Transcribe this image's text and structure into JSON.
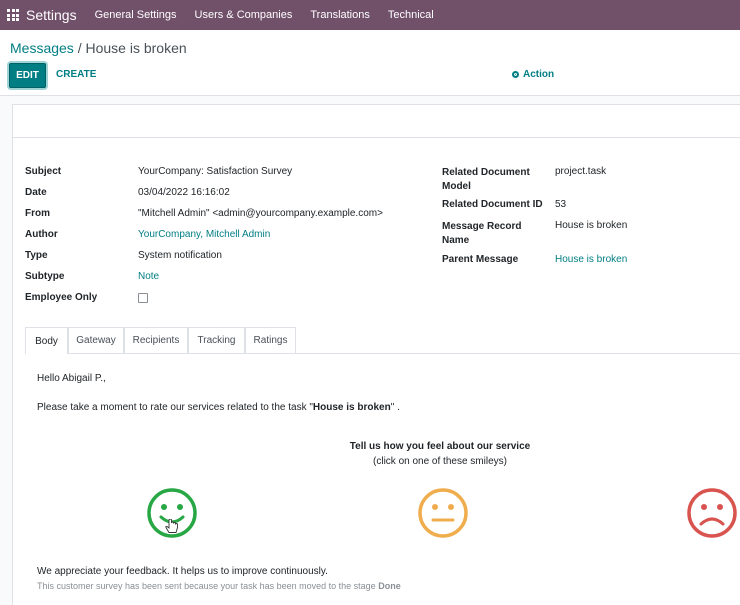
{
  "topbar": {
    "app": "Settings",
    "menus": [
      "General Settings",
      "Users & Companies",
      "Translations",
      "Technical"
    ]
  },
  "breadcrumb": {
    "parent": "Messages",
    "separator": "/",
    "current": "House is broken"
  },
  "buttons": {
    "edit": "EDIT",
    "create": "CREATE",
    "action": "Action"
  },
  "fields_left": [
    {
      "label": "Subject",
      "value": "YourCompany: Satisfaction Survey"
    },
    {
      "label": "Date",
      "value": "03/04/2022 16:16:02"
    },
    {
      "label": "From",
      "value": "\"Mitchell Admin\" <admin@yourcompany.example.com>"
    },
    {
      "label": "Author",
      "value": "YourCompany, Mitchell Admin"
    },
    {
      "label": "Type",
      "value": "System notification"
    },
    {
      "label": "Subtype",
      "value": "Note"
    },
    {
      "label": "Employee Only",
      "value": ""
    }
  ],
  "fields_right": [
    {
      "label": "Related Document Model",
      "label_l1": "Related Document",
      "label_l2": "Model",
      "value": "project.task"
    },
    {
      "label": "Related Document ID",
      "value": "53"
    },
    {
      "label": "Message Record Name",
      "label_l1": "Message Record",
      "label_l2": "Name",
      "value": "House is broken"
    },
    {
      "label": "Parent Message",
      "value": "House is broken"
    }
  ],
  "tabs": [
    "Body",
    "Gateway",
    "Recipients",
    "Tracking",
    "Ratings"
  ],
  "body": {
    "greeting": "Hello Abigail P.,",
    "intro_pre": "Please take a moment to rate our services related to the task \"",
    "intro_task": "House is broken",
    "intro_post": "\" .",
    "prompt_l1": "Tell us how you feel about our service",
    "prompt_l2": "(click on one of these smileys)",
    "thanks": "We appreciate your feedback. It helps us to improve continuously.",
    "footer_pre": "This customer survey has been sent because your task has been moved to the stage ",
    "footer_stage": "Done"
  },
  "colors": {
    "topbar": "#71506a",
    "primary": "#017e84",
    "happy": "#28a745",
    "neutral": "#f0ad4e",
    "sad": "#d9534f"
  }
}
